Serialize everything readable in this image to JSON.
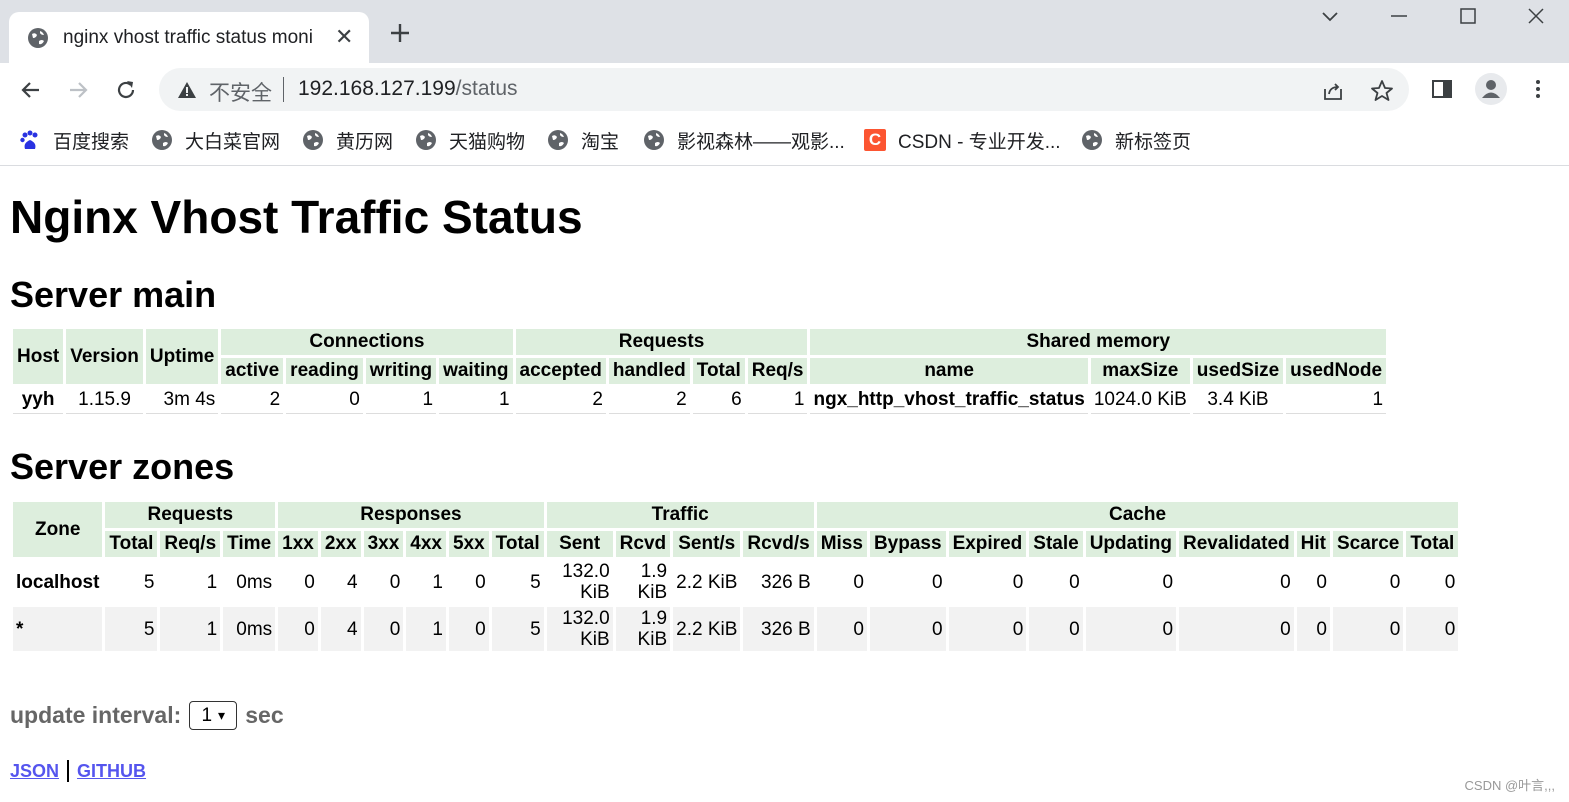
{
  "browser": {
    "tab_title": "nginx vhost traffic status moni",
    "url_security": "不安全",
    "url_host": "192.168.127.199",
    "url_path": "/status",
    "bookmarks": [
      {
        "label": "百度搜索",
        "icon": "baidu-icon"
      },
      {
        "label": "大白菜官网",
        "icon": "globe-icon"
      },
      {
        "label": "黄历网",
        "icon": "globe-icon"
      },
      {
        "label": "天猫购物",
        "icon": "globe-icon"
      },
      {
        "label": "淘宝",
        "icon": "globe-icon"
      },
      {
        "label": "影视森林——观影...",
        "icon": "globe-icon"
      },
      {
        "label": "CSDN - 专业开发...",
        "icon": "csdn-icon"
      },
      {
        "label": "新标签页",
        "icon": "globe-icon"
      }
    ]
  },
  "page": {
    "title": "Nginx Vhost Traffic Status",
    "server_main": {
      "heading": "Server main",
      "group_headers": [
        "Connections",
        "Requests",
        "Shared memory"
      ],
      "headers": {
        "host": "Host",
        "version": "Version",
        "uptime": "Uptime",
        "active": "active",
        "reading": "reading",
        "writing": "writing",
        "waiting": "waiting",
        "accepted": "accepted",
        "handled": "handled",
        "total": "Total",
        "req_s": "Req/s",
        "name": "name",
        "max_size": "maxSize",
        "used_size": "usedSize",
        "used_node": "usedNode"
      },
      "row": {
        "host": "yyh",
        "version": "1.15.9",
        "uptime": "3m 4s",
        "active": "2",
        "reading": "0",
        "writing": "1",
        "waiting": "1",
        "accepted": "2",
        "handled": "2",
        "total": "6",
        "req_s": "1",
        "name": "ngx_http_vhost_traffic_status",
        "max_size": "1024.0 KiB",
        "used_size": "3.4 KiB",
        "used_node": "1"
      }
    },
    "server_zones": {
      "heading": "Server zones",
      "group_headers": {
        "zone": "Zone",
        "requests": "Requests",
        "responses": "Responses",
        "traffic": "Traffic",
        "cache": "Cache"
      },
      "headers": [
        "Total",
        "Req/s",
        "Time",
        "1xx",
        "2xx",
        "3xx",
        "4xx",
        "5xx",
        "Total",
        "Sent",
        "Rcvd",
        "Sent/s",
        "Rcvd/s",
        "Miss",
        "Bypass",
        "Expired",
        "Stale",
        "Updating",
        "Revalidated",
        "Hit",
        "Scarce",
        "Total"
      ],
      "rows": [
        {
          "zone": "localhost",
          "cells": [
            "5",
            "1",
            "0ms",
            "0",
            "4",
            "0",
            "1",
            "0",
            "5",
            "132.0 KiB",
            "1.9 KiB",
            "2.2 KiB",
            "326 B",
            "0",
            "0",
            "0",
            "0",
            "0",
            "0",
            "0",
            "0",
            "0"
          ]
        },
        {
          "zone": "*",
          "cells": [
            "5",
            "1",
            "0ms",
            "0",
            "4",
            "0",
            "1",
            "0",
            "5",
            "132.0 KiB",
            "1.9 KiB",
            "2.2 KiB",
            "326 B",
            "0",
            "0",
            "0",
            "0",
            "0",
            "0",
            "0",
            "0",
            "0"
          ]
        }
      ]
    },
    "update_interval": {
      "label": "update interval:",
      "value": "1",
      "unit": "sec"
    },
    "links": {
      "json": "JSON",
      "github": "GITHUB"
    }
  },
  "watermark": "CSDN @叶言,,,"
}
